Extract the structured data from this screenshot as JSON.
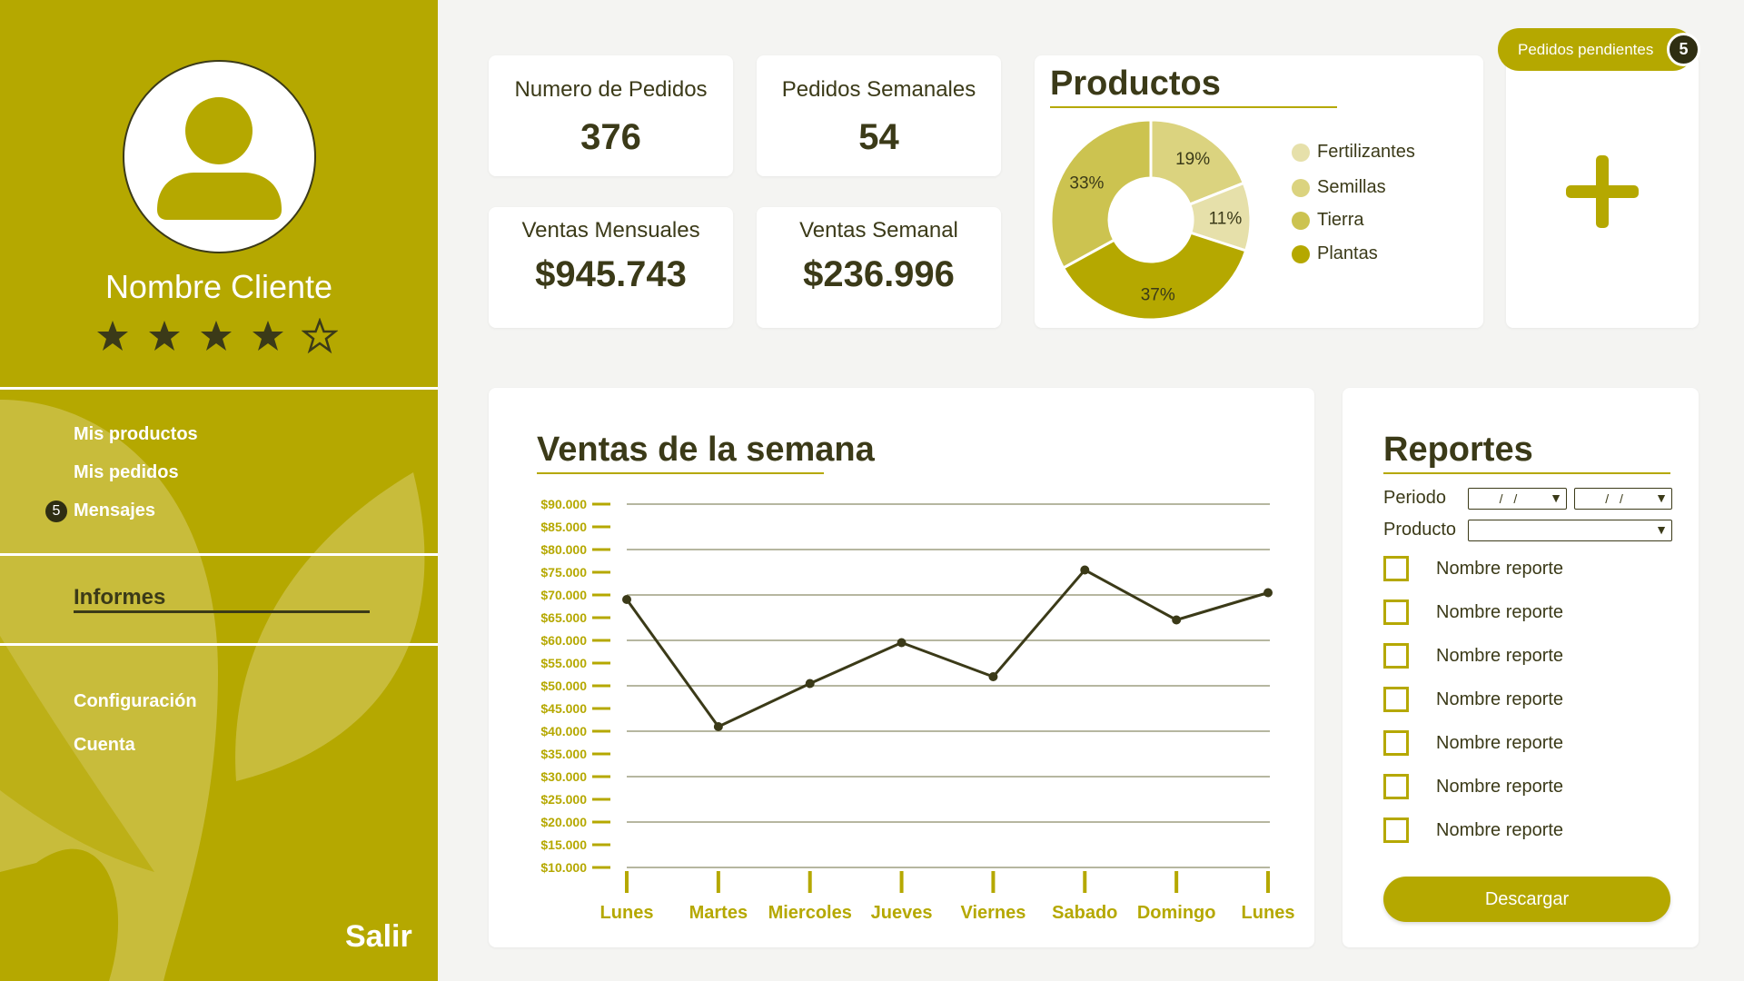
{
  "colors": {
    "accent": "#b5a800",
    "dark": "#3b3a18",
    "light_leaf": "#cbbf45"
  },
  "sidebar": {
    "client_name": "Nombre Cliente",
    "rating": 4,
    "rating_max": 5,
    "nav": [
      {
        "label": "Mis productos"
      },
      {
        "label": "Mis pedidos"
      },
      {
        "label": "Mensajes",
        "badge": "5"
      }
    ],
    "informes": "Informes",
    "settings": [
      {
        "label": "Configuración"
      },
      {
        "label": "Cuenta"
      }
    ],
    "logout": "Salir"
  },
  "stats": [
    {
      "label": "Numero de Pedidos",
      "value": "376"
    },
    {
      "label": "Pedidos Semanales",
      "value": "54"
    },
    {
      "label": "Ventas Mensuales",
      "value": "$945.743"
    },
    {
      "label": "Ventas Semanal",
      "value": "$236.996"
    }
  ],
  "products": {
    "title": "Productos",
    "slices": [
      {
        "name": "Fertilizantes",
        "percent": 11,
        "label": "11%",
        "color": "#e6e0aa"
      },
      {
        "name": "Semillas",
        "percent": 19,
        "label": "19%",
        "color": "#dbd37f"
      },
      {
        "name": "Tierra",
        "percent": 33,
        "label": "33%",
        "color": "#ccc350"
      },
      {
        "name": "Plantas",
        "percent": 37,
        "label": "37%",
        "color": "#b5a800"
      }
    ]
  },
  "pending": {
    "label": "Pedidos pendientes",
    "count": "5",
    "add_icon": "plus-icon"
  },
  "chart_data": {
    "type": "line",
    "title": "Ventas de la semana",
    "categories": [
      "Lunes",
      "Martes",
      "Miercoles",
      "Jueves",
      "Viernes",
      "Sabado",
      "Domingo",
      "Lunes"
    ],
    "values": [
      69000,
      41000,
      50500,
      59500,
      52000,
      75500,
      64500,
      70500
    ],
    "y_ticks": [
      "$10.000",
      "$15.000",
      "$20.000",
      "$25.000",
      "$30.000",
      "$35.000",
      "$40.000",
      "$45.000",
      "$50.000",
      "$55.000",
      "$60.000",
      "$65.000",
      "$70.000",
      "$75.000",
      "$80.000",
      "$85.000",
      "$90.000"
    ],
    "ylim": [
      10000,
      90000
    ],
    "grid": true
  },
  "reports": {
    "title": "Reportes",
    "period_label": "Periodo",
    "date_placeholder": "/ /",
    "product_label": "Producto",
    "items": [
      "Nombre reporte",
      "Nombre reporte",
      "Nombre reporte",
      "Nombre reporte",
      "Nombre reporte",
      "Nombre reporte",
      "Nombre reporte"
    ],
    "download": "Descargar"
  }
}
